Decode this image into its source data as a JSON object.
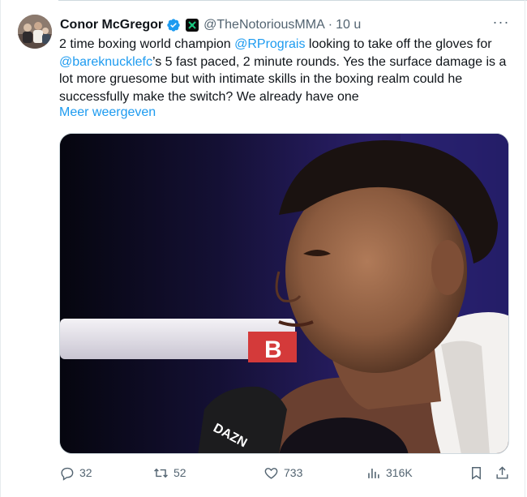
{
  "tweet": {
    "author": {
      "name": "Conor McGregor",
      "handle": "@TheNotoriousMMA",
      "time": "10 u",
      "verified_color": "#1d9bf0"
    },
    "text_parts": [
      "2 time boxing world champion ",
      "@RPrograis",
      " looking to take off the gloves for ",
      "@bareknucklefc",
      "’s 5 fast paced, 2 minute rounds. Yes the surface damage is a lot more gruesome but with intimate skills in the boxing realm could he successfully make the switch? We already have one"
    ],
    "show_more": "Meer weergeven",
    "separator": "·",
    "more_menu": "···",
    "media": {
      "mic_brand": "DAZN",
      "banner_letter": "B"
    },
    "actions": {
      "reply_count": "32",
      "retweet_count": "52",
      "like_count": "733",
      "views_count": "316K"
    }
  },
  "colors": {
    "accent": "#1d9bf0",
    "muted_text": "#536471",
    "text": "#0f1419"
  },
  "icons": [
    "verified-badge-icon",
    "affiliate-badge-icon",
    "more-icon",
    "reply-icon",
    "retweet-icon",
    "like-icon",
    "views-icon",
    "bookmark-icon",
    "share-icon"
  ]
}
